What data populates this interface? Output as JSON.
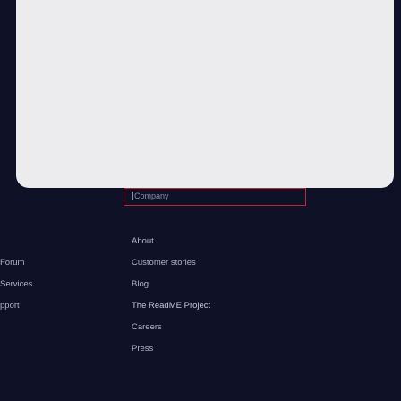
{
  "footer": {
    "left_column": {
      "items": [
        {
          "label": "Forum"
        },
        {
          "label": "Services"
        },
        {
          "label": "pport"
        }
      ]
    },
    "company_column": {
      "heading": "Company",
      "items": [
        {
          "label": "About"
        },
        {
          "label": "Customer stories"
        },
        {
          "label": "Blog"
        },
        {
          "label": "The ReadME Project"
        },
        {
          "label": "Careers"
        },
        {
          "label": "Press"
        }
      ]
    }
  }
}
